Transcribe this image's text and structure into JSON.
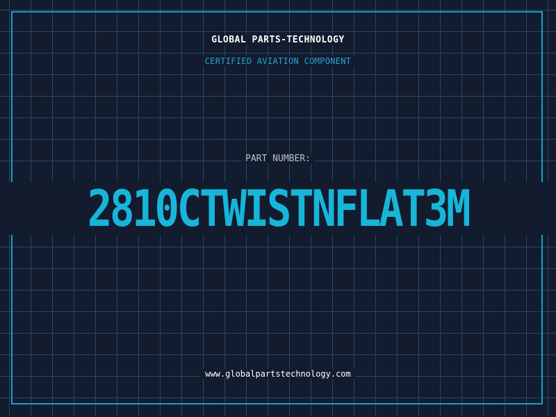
{
  "header": {
    "company": "GLOBAL PARTS-TECHNOLOGY",
    "subtitle": "CERTIFIED AVIATION COMPONENT"
  },
  "part": {
    "label": "PART NUMBER:",
    "number": "2810CTWISTNFLAT3M"
  },
  "footer": {
    "website": "www.globalpartstechnology.com"
  },
  "colors": {
    "background": "#131b2e",
    "grid": "#1e4d62",
    "accent": "#17b6d9",
    "frame": "#1aa0c8"
  }
}
